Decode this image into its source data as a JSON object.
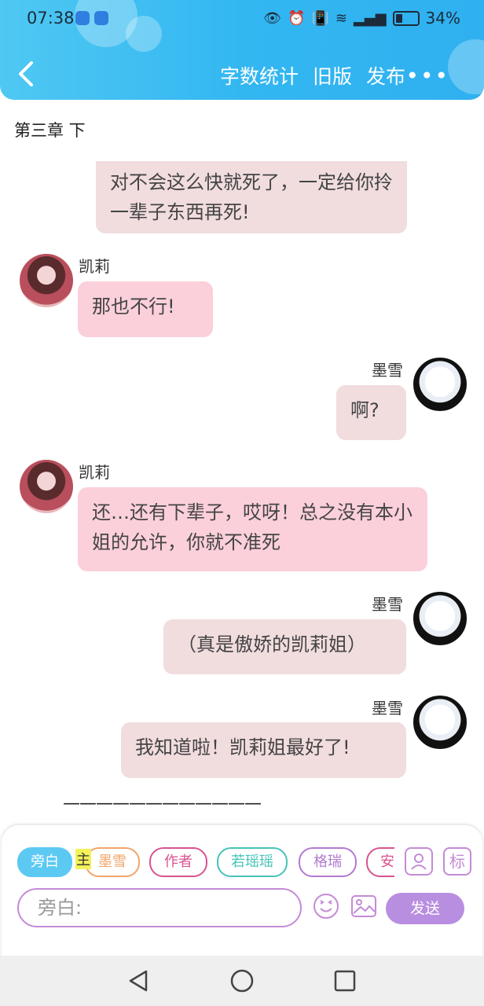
{
  "status_bar": {
    "time": "07:38",
    "battery": "34%"
  },
  "nav": {
    "actions": [
      "字数统计",
      "旧版",
      "发布"
    ],
    "more": "•••"
  },
  "chapter_title": "第三章 下",
  "messages": [
    {
      "side": "right",
      "text": "对不会这么快就死了，一定给你拎一辈子东西再死!"
    },
    {
      "side": "left",
      "name": "凯莉",
      "text": "那也不行!"
    },
    {
      "side": "right",
      "name": "墨雪",
      "text": "啊?"
    },
    {
      "side": "left",
      "name": "凯莉",
      "text": "还…还有下辈子，哎呀！总之没有本小姐的允许，你就不准死"
    },
    {
      "side": "right",
      "name": "墨雪",
      "text": "（真是傲娇的凯莉姐）"
    },
    {
      "side": "right",
      "name": "墨雪",
      "text": "我知道啦！凯莉姐最好了!"
    }
  ],
  "divider": "————————————",
  "role_chips": [
    {
      "label": "旁白",
      "color": "#5cc9f3"
    },
    {
      "label": "墨雪",
      "color": "#f0a46a"
    },
    {
      "label": "作者",
      "color": "#d8548f"
    },
    {
      "label": "若瑶瑶",
      "color": "#46c3b8"
    },
    {
      "label": "格瑞",
      "color": "#b37ad2"
    },
    {
      "label": "安",
      "color": "#d8548f"
    }
  ],
  "main_tag": "主",
  "tag_icon_label": "标",
  "input": {
    "placeholder": "旁白:"
  },
  "send_label": "发送"
}
